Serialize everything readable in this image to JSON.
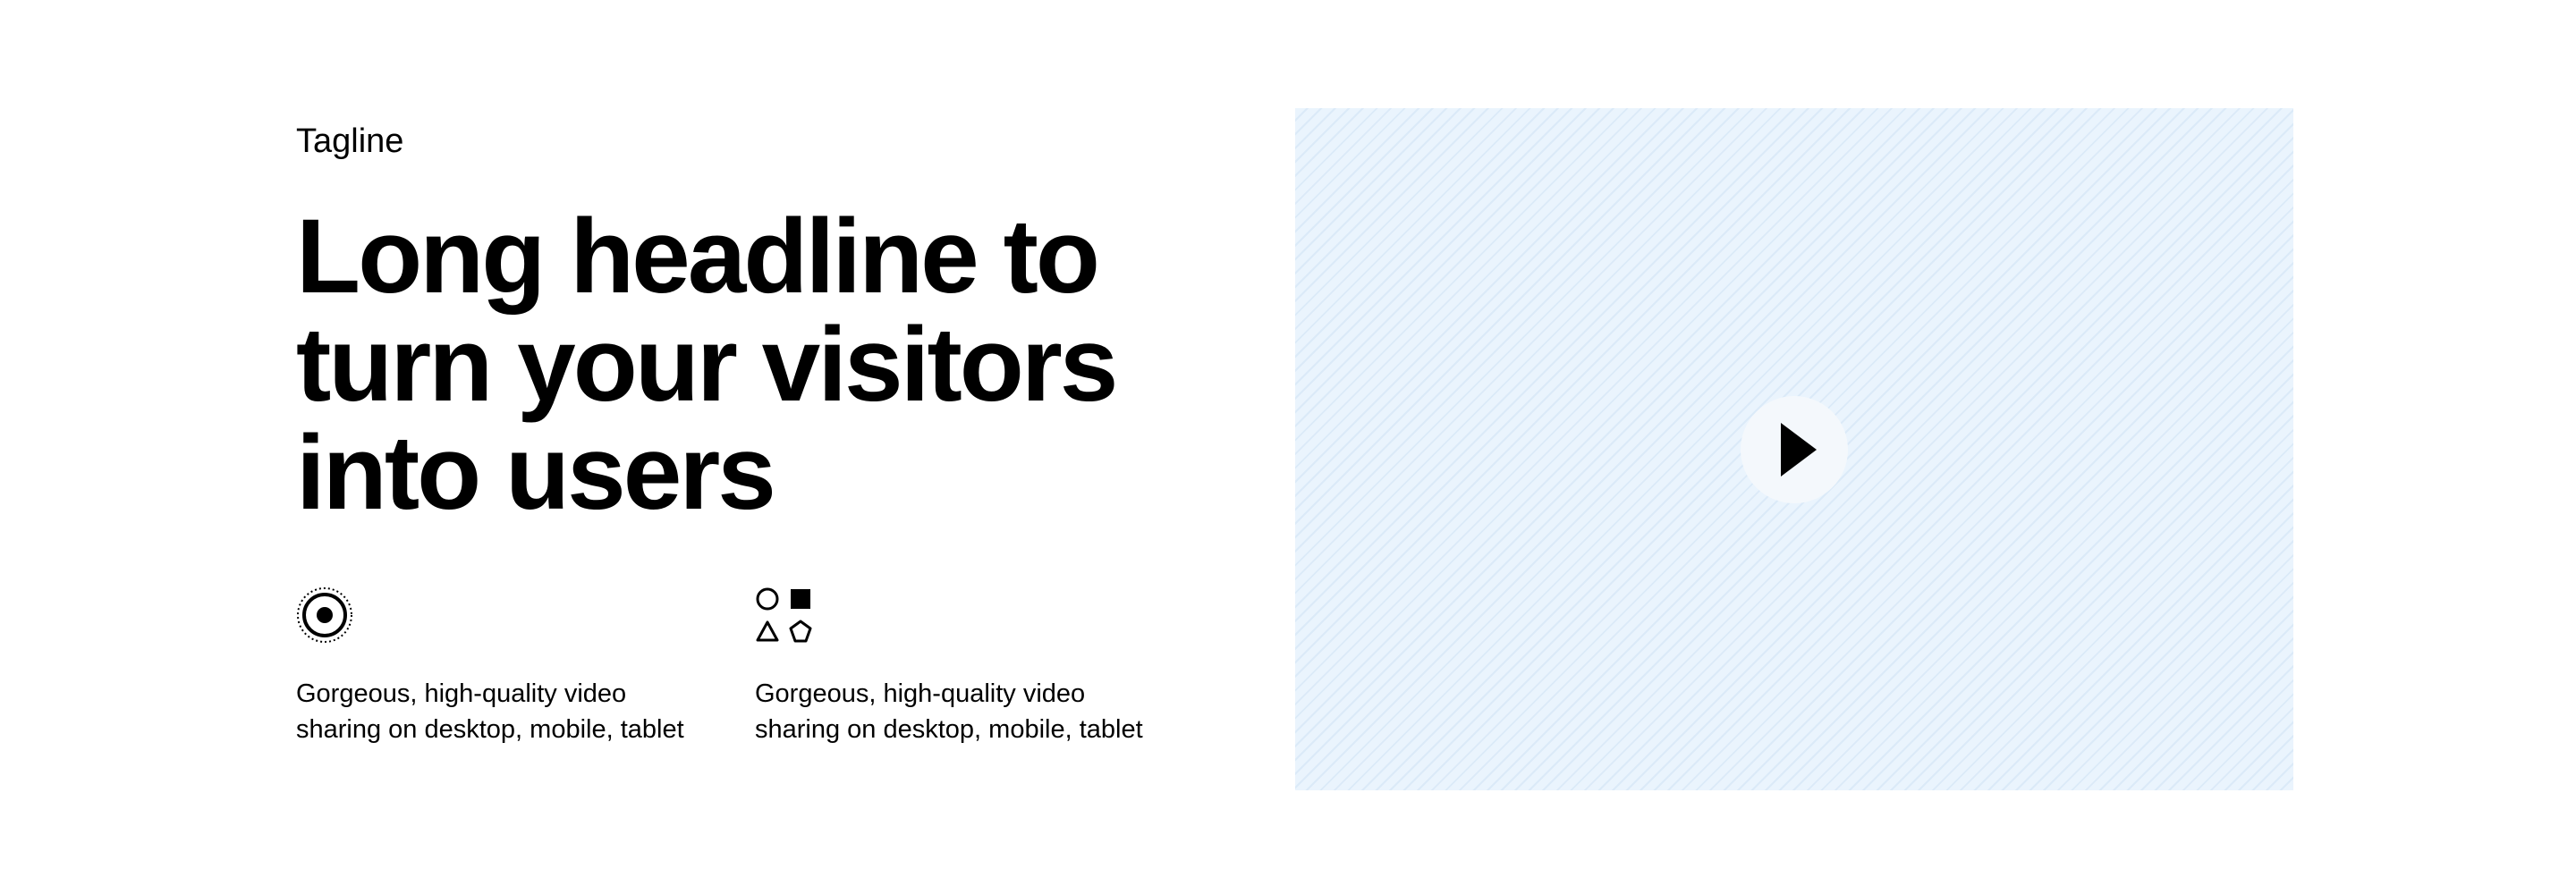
{
  "hero": {
    "tagline": "Tagline",
    "headline_lines": [
      "Long headline to",
      "turn your visitors",
      "into users"
    ]
  },
  "features": [
    {
      "icon": "target-icon",
      "text": "Gorgeous, high-quality video sharing on desktop, mobile, tablet"
    },
    {
      "icon": "shapes-icon",
      "text": "Gorgeous, high-quality video sharing on desktop, mobile, tablet"
    }
  ],
  "media": {
    "icon": "play-icon",
    "background_color": "#eaf4fd",
    "stripe_color": "#dbeaf8"
  }
}
